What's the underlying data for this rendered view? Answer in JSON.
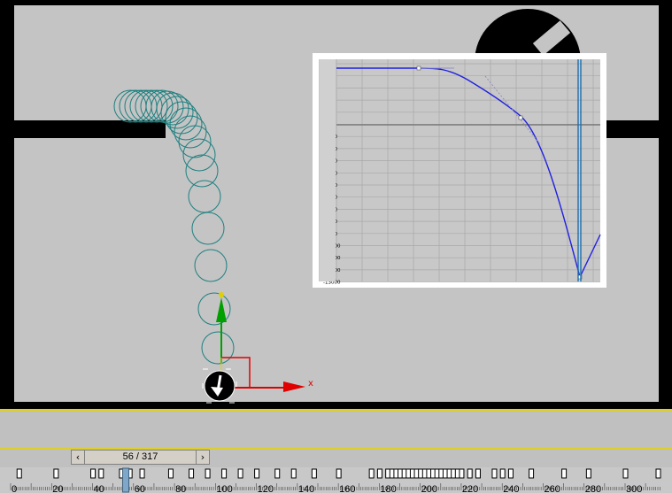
{
  "colors": {
    "viewport_bg": "#c4c4c4",
    "walls": "#000000",
    "trajectory": "#1e7f7f",
    "curve": "#2020e0",
    "grid_bg": "#c8c8c8",
    "axis_x": "#e00000",
    "axis_y": "#00a000",
    "axis_z": "#e0d000",
    "timebar_bg": "#c0c0c0"
  },
  "viewport": {
    "axis_label_x": "x",
    "object_icon": "ball-arrow-icon"
  },
  "curve_editor": {
    "y_ticks": [
      "5000",
      "4000",
      "3000",
      "2000",
      "1000",
      "0",
      "-1000",
      "-2000",
      "-3000",
      "-4000",
      "-5000",
      "-6000",
      "-7000",
      "-8000",
      "-9000",
      "-10000",
      "-11000",
      "-12000",
      "-13000"
    ]
  },
  "time_slider": {
    "frame_readout": "56 / 317",
    "prev_icon": "chevron-left-icon",
    "next_icon": "chevron-right-icon"
  },
  "track_ruler": {
    "labels": [
      "0",
      "20",
      "40",
      "60",
      "80",
      "100",
      "120",
      "140",
      "160",
      "180",
      "200",
      "220",
      "240",
      "260",
      "280",
      "300"
    ]
  }
}
